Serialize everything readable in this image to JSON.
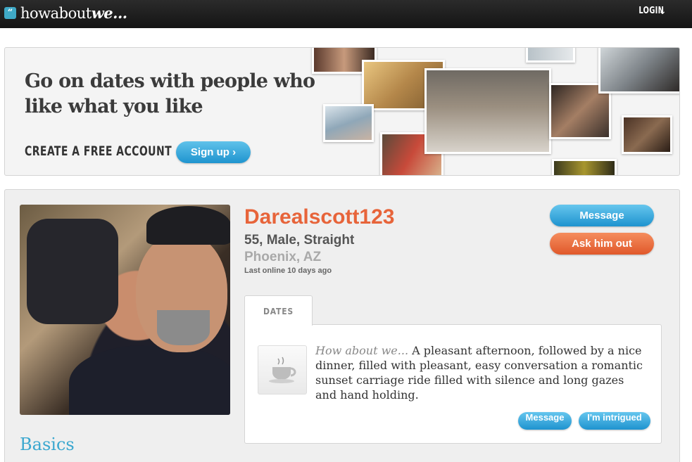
{
  "header": {
    "logo_text_plain": "howabout",
    "logo_text_bold": "we...",
    "login_label": "LOGIN"
  },
  "banner": {
    "title": "Go on dates with people who like what you like",
    "cta": "CREATE A FREE ACCOUNT",
    "signup_label": "Sign up ›"
  },
  "profile": {
    "username": "Darealscott123",
    "demographics": "55, Male, Straight",
    "location": "Phoenix, AZ",
    "last_online": "Last online 10 days ago",
    "message_label": "Message",
    "ask_label": "Ask him out"
  },
  "dates": {
    "tab_label": "DATES",
    "lead": "How about we...",
    "text": " A pleasant afternoon, followed by a nice dinner, filled with pleasant, easy conversation a romantic sunset carriage ride filled with silence and long gazes and hand holding.",
    "message_label": "Message",
    "intrigued_label": "I'm intrigued"
  },
  "section": {
    "basics_label": "Basics"
  },
  "colors": {
    "accent_blue": "#1e93cf",
    "accent_orange": "#e0582a",
    "username": "#e7643a"
  }
}
